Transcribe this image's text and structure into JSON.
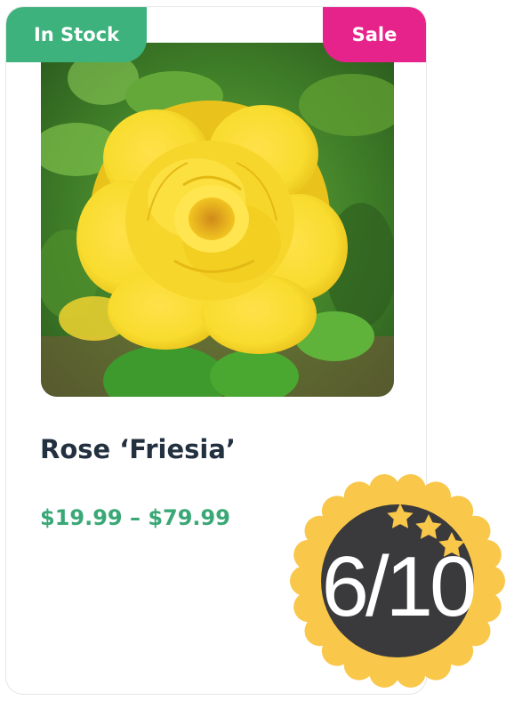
{
  "product": {
    "stock_badge": "In Stock",
    "sale_badge": "Sale",
    "name": "Rose ‘Friesia’",
    "price": "$19.99 – $79.99",
    "image_alt": "yellow-rose-photo"
  },
  "rating": {
    "text": "6/10",
    "value": 6,
    "max": 10,
    "stars_icon_count": 3
  },
  "colors": {
    "in_stock_green": "#3db27c",
    "sale_pink": "#e6238a",
    "title_navy": "#223040",
    "price_green": "#3aa876",
    "badge_gold": "#f9c74a",
    "badge_dark": "#3a3a3c"
  }
}
